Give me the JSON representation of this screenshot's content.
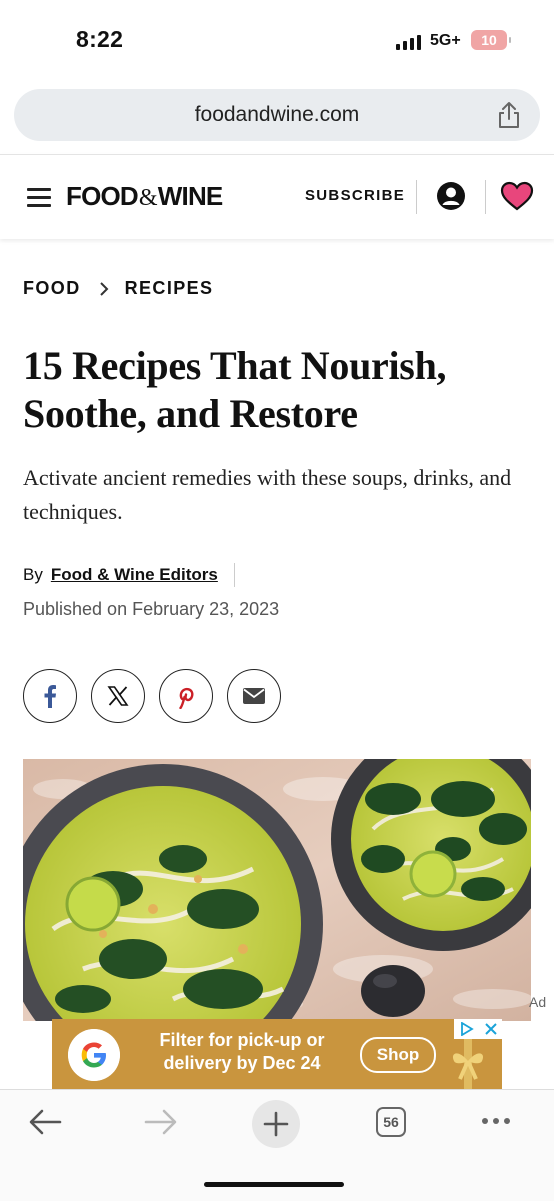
{
  "status_bar": {
    "time": "8:22",
    "network": "5G+",
    "battery": "10"
  },
  "browser": {
    "url": "foodandwine.com",
    "tab_count": "56"
  },
  "site": {
    "logo_left": "FOOD",
    "logo_amp": "&",
    "logo_right": "WINE",
    "subscribe": "SUBSCRIBE",
    "heart_color": "#e8467c"
  },
  "breadcrumb": {
    "items": [
      "FOOD",
      "RECIPES"
    ]
  },
  "article": {
    "title": "15 Recipes That Nourish, Soothe, and Restore",
    "dek": "Activate ancient remedies with these soups, drinks, and techniques.",
    "by": "By",
    "author": "Food & Wine Editors",
    "published": "Published on February 23, 2023"
  },
  "share": {
    "icons": [
      "facebook-icon",
      "x-icon",
      "pinterest-icon",
      "email-icon"
    ]
  },
  "ad": {
    "label": "Ad",
    "text": "Filter for pick-up or delivery by Dec 24",
    "button": "Shop",
    "background": "#c9953e"
  }
}
